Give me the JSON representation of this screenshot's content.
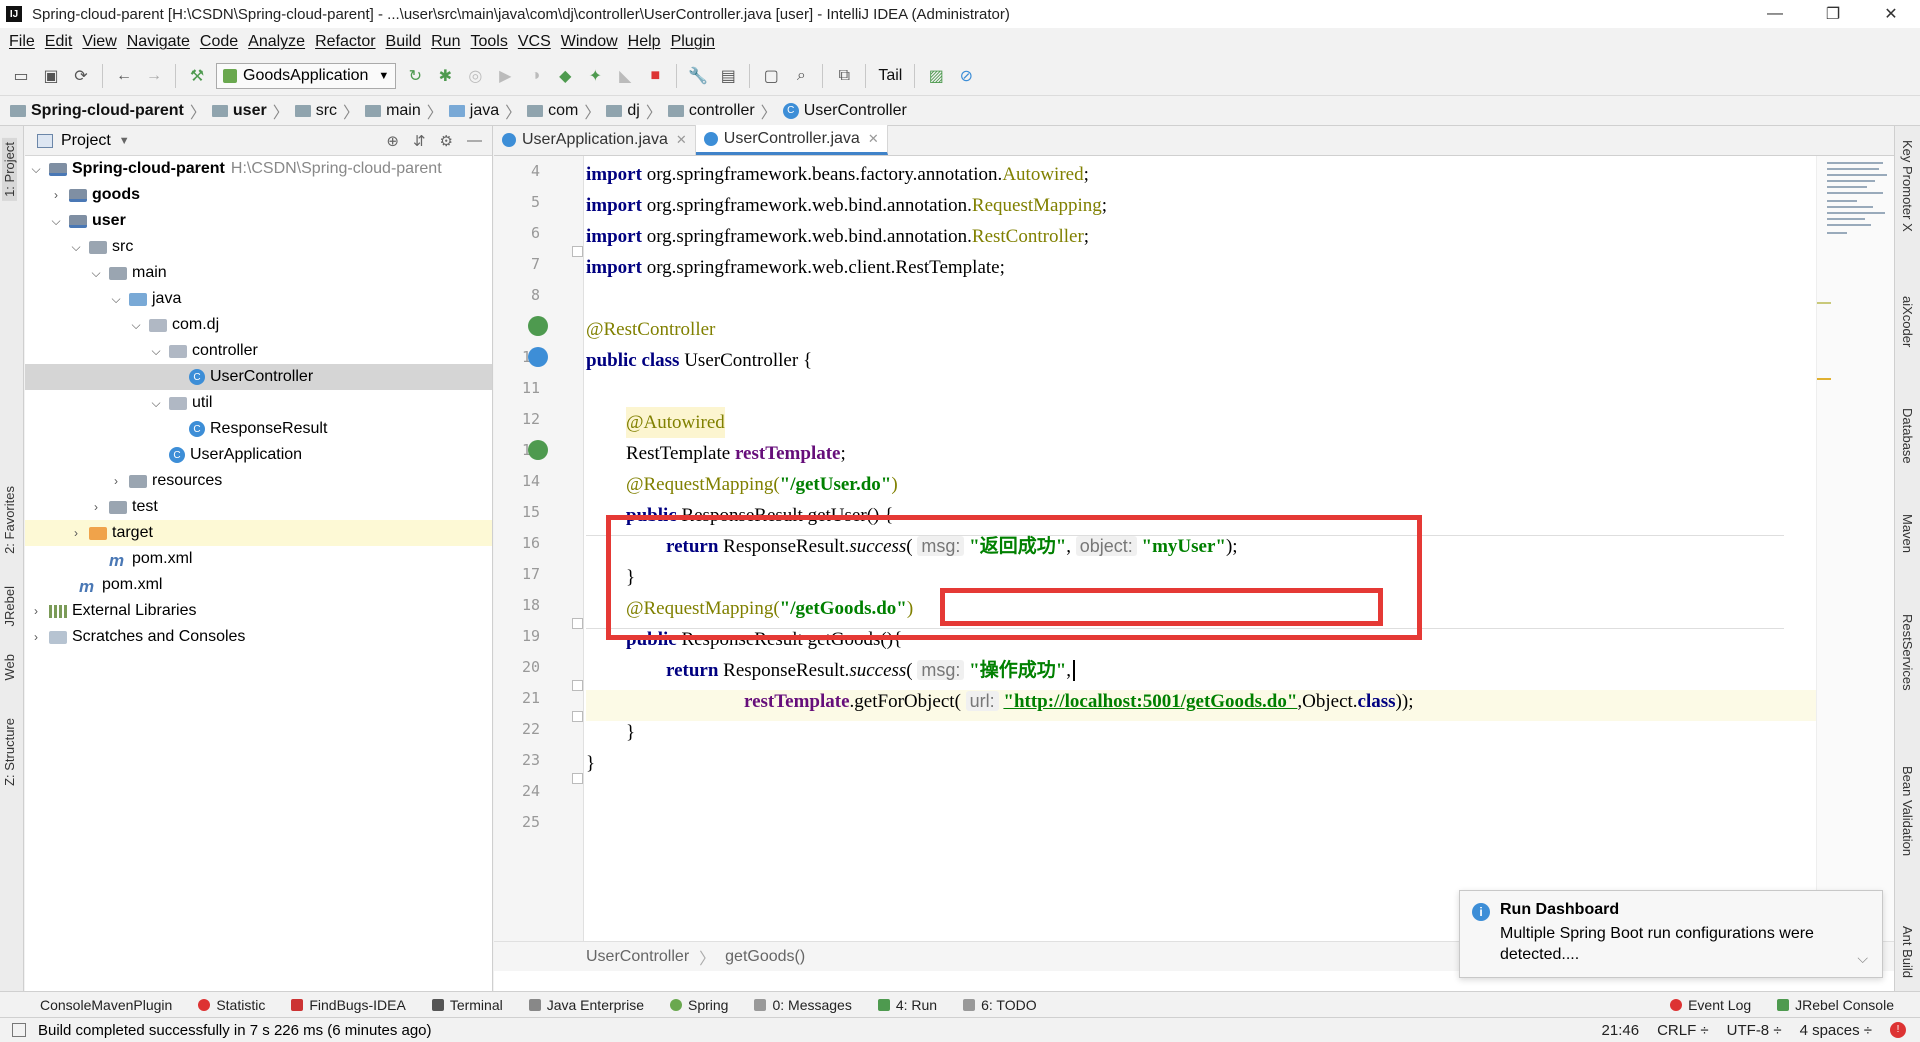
{
  "window": {
    "title": "Spring-cloud-parent [H:\\CSDN\\Spring-cloud-parent] - ...\\user\\src\\main\\java\\com\\dj\\controller\\UserController.java [user] - IntelliJ IDEA (Administrator)",
    "app_icon": "IJ",
    "minimize": "—",
    "maximize": "❐",
    "close": "✕"
  },
  "menu": [
    "File",
    "Edit",
    "View",
    "Navigate",
    "Code",
    "Analyze",
    "Refactor",
    "Build",
    "Run",
    "Tools",
    "VCS",
    "Window",
    "Help",
    "Plugin"
  ],
  "toolbar": {
    "run_config": "GoodsApplication",
    "tail_label": "Tail"
  },
  "breadcrumbs": [
    "Spring-cloud-parent",
    "user",
    "src",
    "main",
    "java",
    "com",
    "dj",
    "controller",
    "UserController"
  ],
  "left_strip": [
    "1: Project",
    "2: Favorites",
    "JRebel",
    "Web",
    "Z: Structure"
  ],
  "right_strip": [
    "Key Promoter X",
    "aiXcoder",
    "Database",
    "Maven",
    "RestServices",
    "Bean Validation",
    "Ant Build"
  ],
  "project": {
    "header": "Project",
    "root_path": "H:\\CSDN\\Spring-cloud-parent",
    "tree": [
      {
        "label": "Spring-cloud-parent",
        "bold": true
      },
      {
        "label": "goods",
        "bold": true
      },
      {
        "label": "user",
        "bold": true
      },
      {
        "label": "src"
      },
      {
        "label": "main"
      },
      {
        "label": "java"
      },
      {
        "label": "com.dj"
      },
      {
        "label": "controller"
      },
      {
        "label": "UserController"
      },
      {
        "label": "util"
      },
      {
        "label": "ResponseResult"
      },
      {
        "label": "UserApplication"
      },
      {
        "label": "resources"
      },
      {
        "label": "test"
      },
      {
        "label": "target"
      },
      {
        "label": "pom.xml"
      },
      {
        "label": "pom.xml"
      },
      {
        "label": "External Libraries"
      },
      {
        "label": "Scratches and Consoles"
      }
    ]
  },
  "editor": {
    "tabs": [
      "UserApplication.java",
      "UserController.java"
    ],
    "line_numbers": [
      "4",
      "5",
      "6",
      "7",
      "8",
      "9",
      "10",
      "11",
      "12",
      "13",
      "14",
      "15",
      "16",
      "17",
      "18",
      "19",
      "20",
      "21",
      "22",
      "23",
      "24",
      "25"
    ],
    "imports": [
      {
        "pre": "org.springframework.beans.factory.annotation.",
        "name": "Autowired"
      },
      {
        "pre": "org.springframework.web.bind.annotation.",
        "name": "RequestMapping"
      },
      {
        "pre": "org.springframework.web.bind.annotation.",
        "name": "RestController"
      },
      {
        "pre": "org.springframework.web.client.",
        "name": "RestTemplate"
      }
    ],
    "kw_import": "import",
    "kw_public": "public",
    "kw_class": "class",
    "kw_return": "return",
    "semicolon": ";",
    "ann_rest_controller": "@RestController",
    "class_name": "UserController",
    "brace_open": " {",
    "ann_autowired": "@Autowired",
    "field_type": "RestTemplate",
    "field_name": "restTemplate",
    "ann_request_mapping": "@RequestMapping",
    "path_get_user": "\"/getUser.do\"",
    "path_get_goods": "\"/getGoods.do\"",
    "return_type": "ResponseResult",
    "method_get_user": "getUser",
    "method_get_goods": "getGoods",
    "resp_class": "ResponseResult.",
    "success": "success",
    "hint_msg": "msg:",
    "hint_object": "object:",
    "hint_url": "url:",
    "msg_user": "\"返回成功\"",
    "obj_user": "\"myUser\"",
    "msg_goods": "\"操作成功\"",
    "get_for_object": "getForObject",
    "url": "\"http://localhost:5001/getGoods.do\"",
    "object_class": "Object.",
    "class_kw": "class",
    "close_brace": "}",
    "bottom_crumbs": [
      "UserController",
      "getGoods()"
    ]
  },
  "notification": {
    "title": "Run Dashboard",
    "body": "Multiple Spring Boot run configurations were detected...."
  },
  "tool_windows": [
    "ConsoleMavenPlugin",
    "Statistic",
    "FindBugs-IDEA",
    "Terminal",
    "Java Enterprise",
    "Spring",
    "0: Messages",
    "4: Run",
    "6: TODO",
    "Event Log",
    "JRebel Console"
  ],
  "status": {
    "message": "Build completed successfully in 7 s 226 ms (6 minutes ago)",
    "position": "21:46",
    "line_sep": "CRLF ÷",
    "encoding": "UTF-8 ÷",
    "indent": "4 spaces ÷"
  },
  "colors": {
    "highlight_box": "#e53935",
    "keyword": "#000080",
    "annotation": "#808000",
    "string": "#008000",
    "field": "#660e7a"
  }
}
